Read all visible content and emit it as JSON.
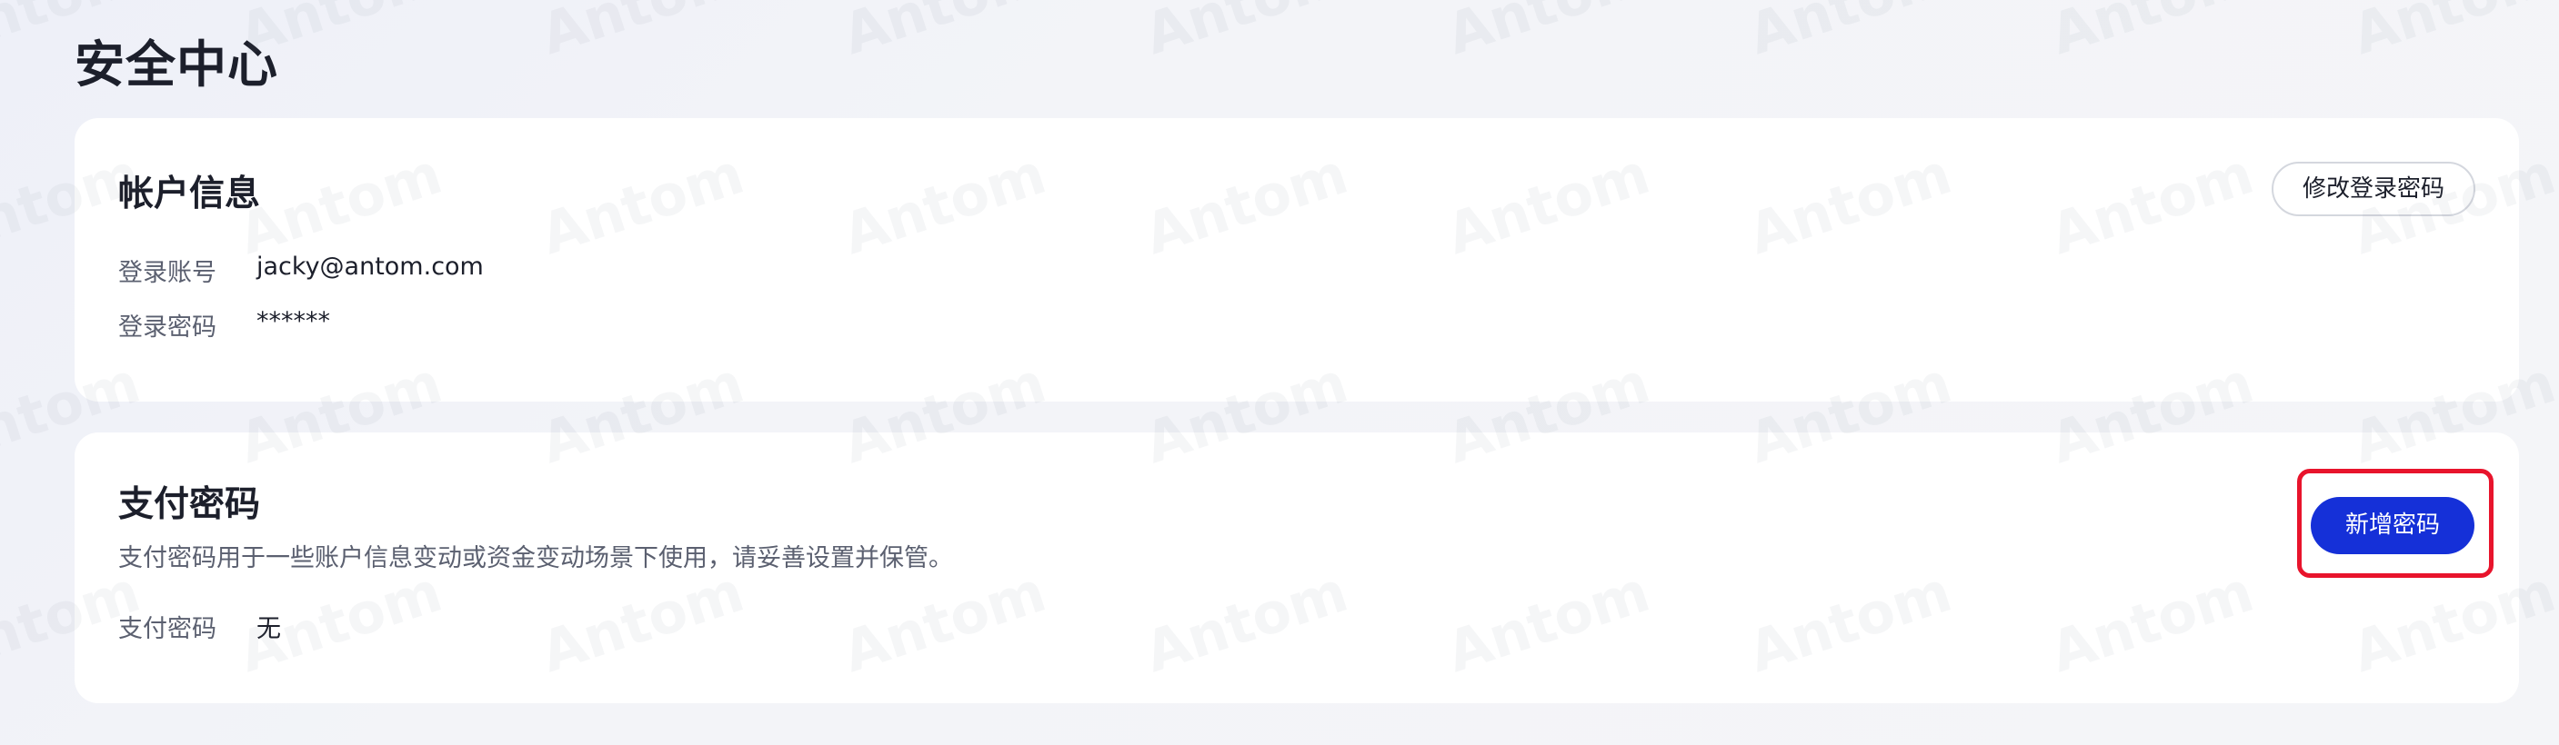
{
  "page": {
    "title": "安全中心"
  },
  "account_card": {
    "title": "帐户信息",
    "change_password_button": "修改登录密码",
    "rows": [
      {
        "label": "登录账号",
        "value": "jacky@antom.com"
      },
      {
        "label": "登录密码",
        "value": "******"
      }
    ]
  },
  "payment_card": {
    "title": "支付密码",
    "description": "支付密码用于一些账户信息变动或资金变动场景下使用，请妥善设置并保管。",
    "add_password_button": "新增密码",
    "rows": [
      {
        "label": "支付密码",
        "value": "无"
      }
    ]
  },
  "watermark": {
    "text": "Antom"
  },
  "colors": {
    "primary_button": "#1530d8",
    "highlight_border": "#e8142c",
    "background": "#f3f4f8",
    "card": "#ffffff"
  }
}
